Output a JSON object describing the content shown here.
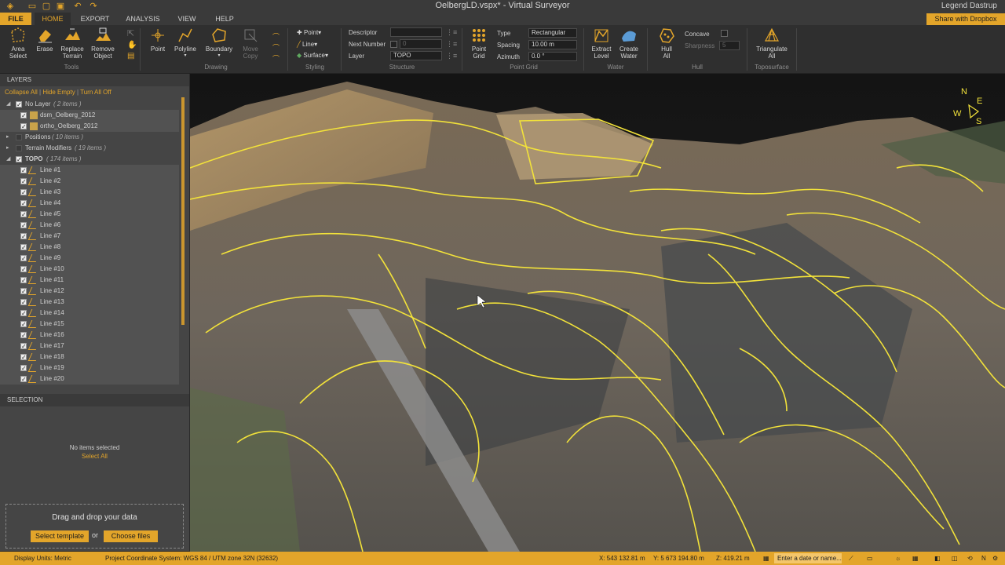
{
  "window": {
    "title": "OelbergLD.vspx* - Virtual Surveyor",
    "user": "Legend Dastrup",
    "dropbox": "Share with Dropbox"
  },
  "menu": {
    "tabs": [
      "FILE",
      "HOME",
      "EXPORT",
      "ANALYSIS",
      "VIEW",
      "HELP"
    ]
  },
  "ribbon": {
    "tools": {
      "label": "Tools",
      "buttons": [
        "Area\nSelect",
        "Erase",
        "Replace\nTerrain",
        "Remove\nObject"
      ]
    },
    "drawing": {
      "label": "Drawing",
      "buttons": [
        "Point",
        "Polyline",
        "Boundary",
        "Move\nCopy"
      ]
    },
    "styling": {
      "label": "Styling",
      "items": [
        "Point",
        "Line",
        "Surface"
      ]
    },
    "structure": {
      "label": "Structure",
      "descriptor_label": "Descriptor",
      "next_number_label": "Next Number",
      "next_number_value": "0",
      "layer_label": "Layer",
      "layer_value": "TOPO"
    },
    "point_grid": {
      "label": "Point Grid",
      "button": "Point\nGrid",
      "type_label": "Type",
      "type_value": "Rectangular",
      "spacing_label": "Spacing",
      "spacing_value": "10.00 m",
      "azimuth_label": "Azimuth",
      "azimuth_value": "0.0 °"
    },
    "water": {
      "label": "Water",
      "buttons": [
        "Extract\nLevel",
        "Create\nWater"
      ]
    },
    "hull": {
      "label": "Hull",
      "button": "Hull\nAll",
      "concave_label": "Concave",
      "sharpness_label": "Sharpness",
      "sharpness_value": "5"
    },
    "toposurface": {
      "label": "Toposurface",
      "button": "Triangulate\nAll"
    }
  },
  "layers": {
    "header": "LAYERS",
    "actions": [
      "Collapse All",
      "Hide Empty",
      "Turn All Off"
    ],
    "groups": [
      {
        "name": "No Layer",
        "count": "( 2 items )"
      },
      {
        "name": "Positions",
        "count": "( 10 items )"
      },
      {
        "name": "Terrain Modifiers",
        "count": "( 19 items )"
      },
      {
        "name": "TOPO",
        "count": "( 174 items )"
      }
    ],
    "nolayer_items": [
      "dsm_Oelberg_2012",
      "ortho_Oelberg_2012"
    ],
    "topo_items": [
      "Line #1",
      "Line #2",
      "Line #3",
      "Line #4",
      "Line #5",
      "Line #6",
      "Line #7",
      "Line #8",
      "Line #9",
      "Line #10",
      "Line #11",
      "Line #12",
      "Line #13",
      "Line #14",
      "Line #15",
      "Line #16",
      "Line #17",
      "Line #18",
      "Line #19",
      "Line #20"
    ]
  },
  "selection": {
    "header": "SELECTION",
    "empty": "No items selected",
    "select_all": "Select All",
    "drop_message": "Drag and drop your data",
    "select_template": "Select template",
    "or": "or",
    "choose_files": "Choose files"
  },
  "compass": {
    "n": "N",
    "e": "E",
    "s": "S",
    "w": "W"
  },
  "status": {
    "display_units": "Display Units: Metric",
    "coord_system": "Project Coordinate System:  WGS 84 / UTM zone 32N (32632)",
    "x": "X: 543 132.81 m",
    "y": "Y: 5 673 194.80 m",
    "z": "Z: 419.21 m",
    "date_placeholder": "Enter a date or name..."
  },
  "colors": {
    "accent": "#e3a52a",
    "contour": "#f2e23a"
  }
}
